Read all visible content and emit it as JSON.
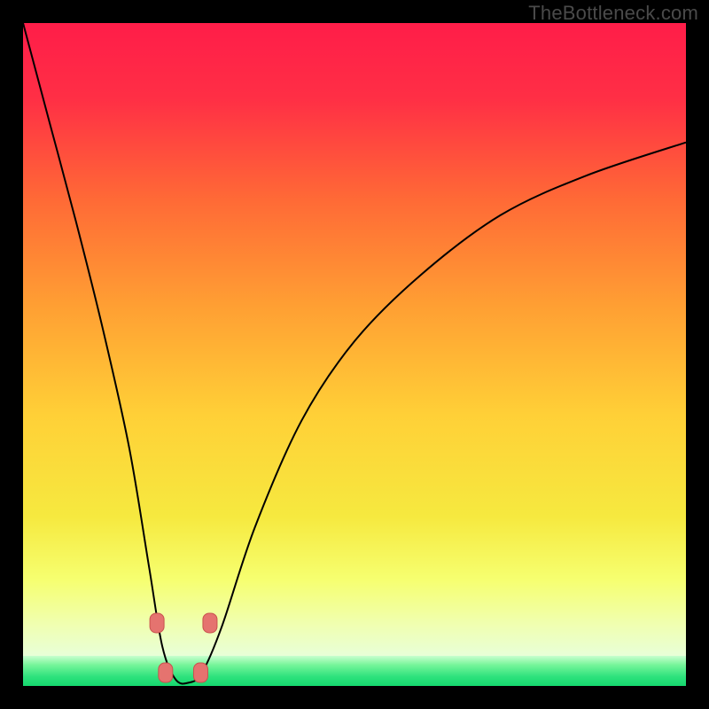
{
  "watermark": {
    "text": "TheBottleneck.com"
  },
  "colors": {
    "gradient_stops": [
      {
        "offset": 0.0,
        "color": "#ff1d49"
      },
      {
        "offset": 0.12,
        "color": "#ff2f45"
      },
      {
        "offset": 0.28,
        "color": "#ff6a36"
      },
      {
        "offset": 0.45,
        "color": "#ffa033"
      },
      {
        "offset": 0.62,
        "color": "#ffd037"
      },
      {
        "offset": 0.78,
        "color": "#f6e93f"
      },
      {
        "offset": 0.88,
        "color": "#f6ff70"
      },
      {
        "offset": 0.95,
        "color": "#f0ffb0"
      },
      {
        "offset": 1.0,
        "color": "#e8ffd8"
      }
    ],
    "green_band_stops": [
      {
        "offset": 0.0,
        "color": "#c8ffcf"
      },
      {
        "offset": 0.3,
        "color": "#76f59a"
      },
      {
        "offset": 0.7,
        "color": "#2de27c"
      },
      {
        "offset": 1.0,
        "color": "#15d86e"
      }
    ],
    "curve": "#000000",
    "marker_fill": "#e5736f",
    "marker_stroke": "#c9524e"
  },
  "chart_data": {
    "type": "line",
    "title": "",
    "xlabel": "",
    "ylabel": "",
    "x_range": [
      0,
      100
    ],
    "y_range": [
      0,
      100
    ],
    "curve_note": "V-shaped bottleneck curve; minimum near x≈24, y≈0. Left branch rises to y≈100 at x≈0; right branch rises to y≈82 at x≈100.",
    "series": [
      {
        "name": "bottleneck-curve",
        "points": [
          {
            "x": 0.0,
            "y": 100.0
          },
          {
            "x": 4.0,
            "y": 85.0
          },
          {
            "x": 8.0,
            "y": 70.0
          },
          {
            "x": 12.0,
            "y": 54.0
          },
          {
            "x": 16.0,
            "y": 36.0
          },
          {
            "x": 19.0,
            "y": 18.0
          },
          {
            "x": 21.0,
            "y": 6.0
          },
          {
            "x": 23.0,
            "y": 1.0
          },
          {
            "x": 25.0,
            "y": 0.5
          },
          {
            "x": 27.0,
            "y": 2.0
          },
          {
            "x": 30.0,
            "y": 9.0
          },
          {
            "x": 35.0,
            "y": 24.0
          },
          {
            "x": 42.0,
            "y": 40.0
          },
          {
            "x": 50.0,
            "y": 52.0
          },
          {
            "x": 60.0,
            "y": 62.0
          },
          {
            "x": 72.0,
            "y": 71.0
          },
          {
            "x": 85.0,
            "y": 77.0
          },
          {
            "x": 100.0,
            "y": 82.0
          }
        ]
      }
    ],
    "markers": [
      {
        "x": 20.2,
        "y": 9.5
      },
      {
        "x": 28.2,
        "y": 9.5
      },
      {
        "x": 21.5,
        "y": 2.0
      },
      {
        "x": 26.8,
        "y": 2.0
      }
    ]
  }
}
